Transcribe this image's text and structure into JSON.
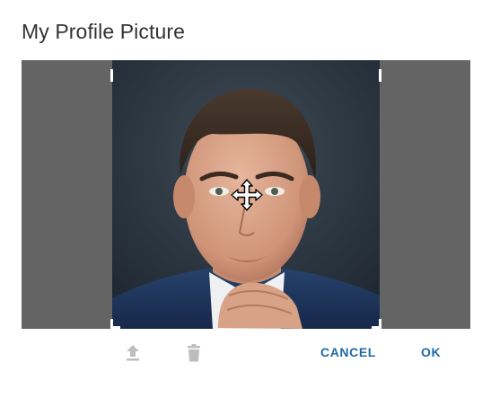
{
  "dialog": {
    "title": "My Profile Picture"
  },
  "cropper": {
    "image_subject": "portrait of a young man in a dark suit, hand on chin",
    "move_cursor_icon": "move-arrows-icon"
  },
  "toolbar": {
    "upload_icon": "upload-icon",
    "delete_icon": "trash-icon",
    "cancel_label": "CANCEL",
    "ok_label": "OK"
  },
  "colors": {
    "accent": "#1f6aa5",
    "disabled_icon": "#bdbdbd",
    "cropper_background": "#646464",
    "title_text": "#333333"
  }
}
